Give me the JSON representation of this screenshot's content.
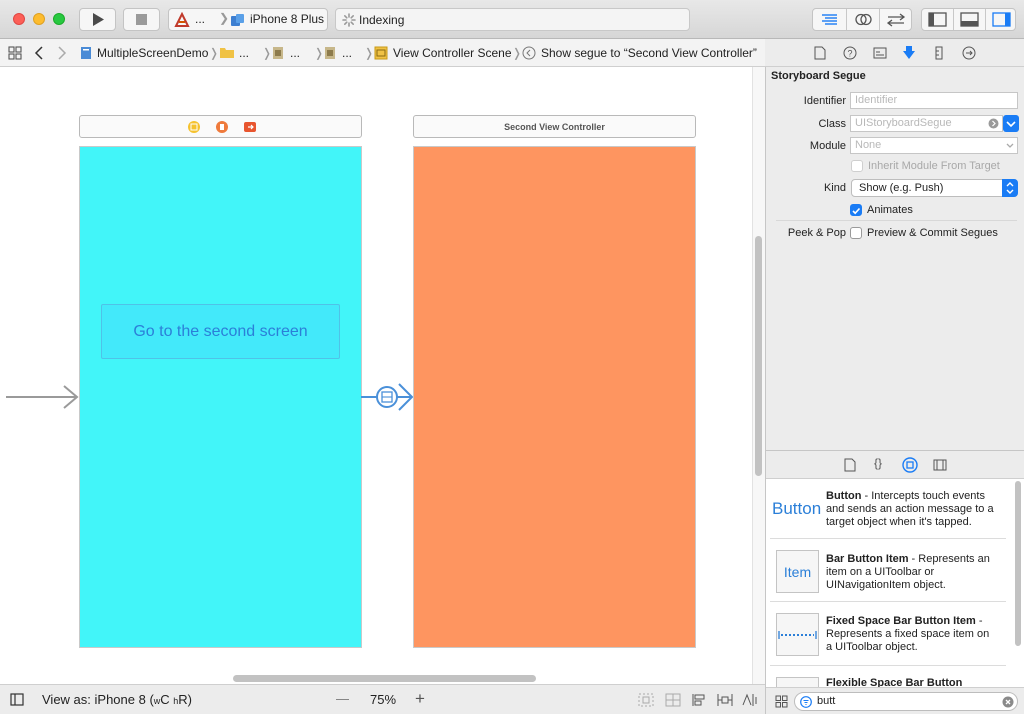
{
  "toolbar": {
    "scheme_app": "...",
    "scheme_device": "iPhone 8 Plus",
    "status_text": "Indexing"
  },
  "jumpbar": {
    "project": "MultipleScreenDemo",
    "folder": "...",
    "file1": "...",
    "file2": "...",
    "scene": "View Controller Scene",
    "segue": "Show segue to “Second View Controller”"
  },
  "canvas": {
    "button_title": "Go to the second screen",
    "second_scene_title": "Second View Controller",
    "first_bg": "#42f5f9",
    "second_bg": "#fe9560"
  },
  "bottombar": {
    "view_as": "View as: iPhone 8 (",
    "size_class_w": "w",
    "size_class_c": "C ",
    "size_class_h": "h",
    "size_class_r": "R)",
    "zoom": "75%",
    "minus": "—",
    "plus": "+"
  },
  "inspector": {
    "section_title": "Storyboard Segue",
    "identifier_label": "Identifier",
    "identifier_placeholder": "Identifier",
    "class_label": "Class",
    "class_placeholder": "UIStoryboardSegue",
    "module_label": "Module",
    "module_value": "None",
    "inherit_label": "Inherit Module From Target",
    "kind_label": "Kind",
    "kind_value": "Show (e.g. Push)",
    "animates_label": "Animates",
    "animates_checked": true,
    "peekpop_label": "Peek & Pop",
    "preview_label": "Preview & Commit Segues",
    "preview_checked": false
  },
  "library": {
    "items": [
      {
        "icon_text": "Button",
        "title": "Button",
        "desc": " - Intercepts touch events and sends an action message to a target object when it's tapped."
      },
      {
        "icon_text": "Item",
        "title": "Bar Button Item",
        "desc": " - Represents an item on a UIToolbar or UINavigationItem object."
      },
      {
        "icon_text": "",
        "title": "Fixed Space Bar Button Item",
        "desc": " - Represents a fixed space item on a UIToolbar object."
      },
      {
        "icon_text": "",
        "title": "Flexible Space Bar Button",
        "desc": ""
      }
    ],
    "filter_value": "butt"
  },
  "colors": {
    "accent": "#1a7cf5",
    "link_blue": "#2b7fd8"
  }
}
